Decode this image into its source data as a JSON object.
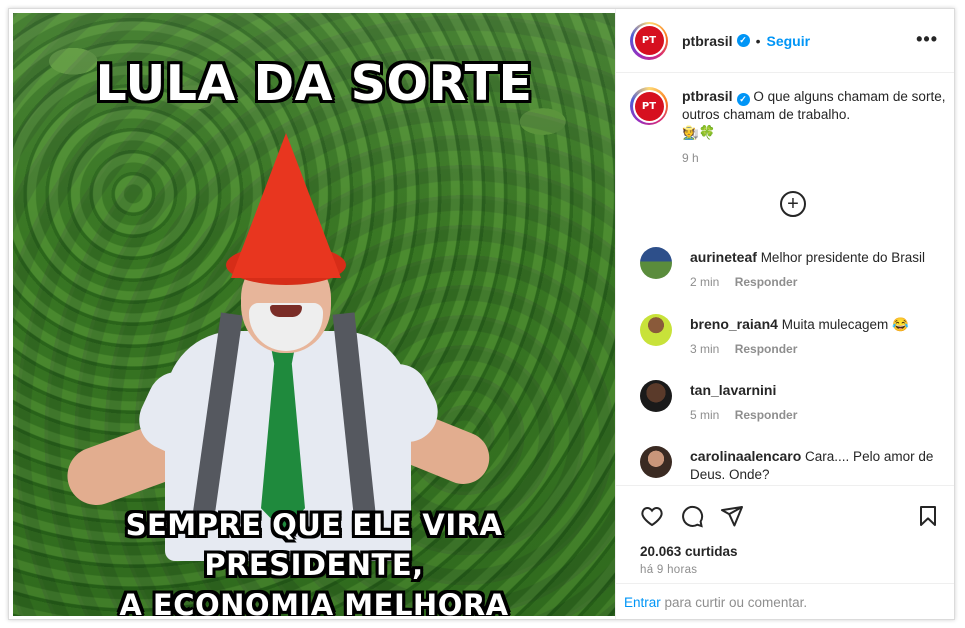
{
  "meme": {
    "top_text": "LULA DA SORTE",
    "bottom_line1": "SEMPRE QUE ELE VIRA PRESIDENTE,",
    "bottom_line2": "A ECONOMIA MELHORA"
  },
  "header": {
    "avatar_text": "PT",
    "username": "ptbrasil",
    "separator": "•",
    "follow_label": "Seguir",
    "more_label": "•••"
  },
  "caption": {
    "avatar_text": "PT",
    "username": "ptbrasil",
    "text": "O que alguns chamam de sorte, outros chamam de trabalho.",
    "emojis": "🧑‍🌾🍀",
    "time": "9 h"
  },
  "comments": [
    {
      "username": "aurineteaf",
      "text": "Melhor presidente do Brasil",
      "time": "2 min",
      "reply": "Responder"
    },
    {
      "username": "breno_raian4",
      "text": "Muita mulecagem 😂",
      "time": "3 min",
      "reply": "Responder"
    },
    {
      "username": "tan_lavarnini",
      "text": "",
      "time": "5 min",
      "reply": "Responder"
    },
    {
      "username": "carolinaalencaro",
      "text": "Cara.... Pelo amor de Deus. Onde?",
      "time": "",
      "reply": ""
    }
  ],
  "actions": {
    "likes": "20.063 curtidas",
    "posted": "há 9 horas"
  },
  "login": {
    "enter": "Entrar",
    "rest": " para curtir ou comentar."
  },
  "colors": {
    "accent": "#0095f6",
    "pt_red": "#d6101f",
    "muted": "#8e8e8e"
  }
}
